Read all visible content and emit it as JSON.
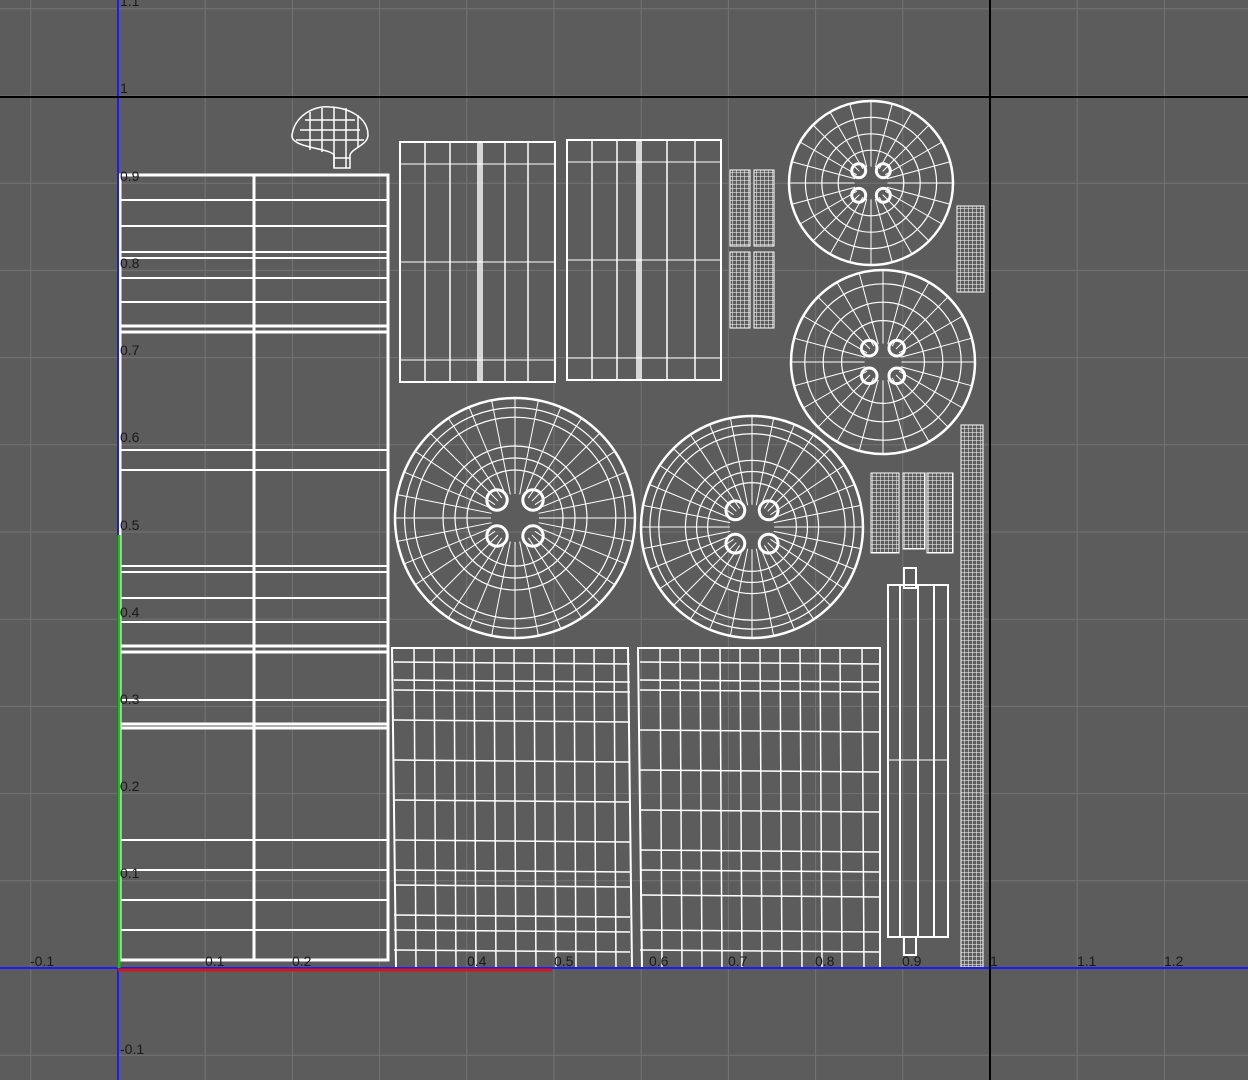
{
  "viewport": {
    "background_color": "#5c5c5c",
    "grid_color": "#737373",
    "uv_wire_color": "#ffffff",
    "u_axis_color": "#1a1aff",
    "v_axis_color": "#1a1aff",
    "u_highlight_color": "#d01818",
    "v_highlight_color": "#19c019",
    "boundary_color": "#000000"
  },
  "axis": {
    "u_ticks": [
      {
        "id": "u-neg0p1",
        "label": "-0.1"
      },
      {
        "id": "u-0p1",
        "label": "0.1"
      },
      {
        "id": "u-0p2",
        "label": "0.2"
      },
      {
        "id": "u-0p4",
        "label": "0.4"
      },
      {
        "id": "u-0p5",
        "label": "0.5"
      },
      {
        "id": "u-0p6",
        "label": "0.6"
      },
      {
        "id": "u-0p7",
        "label": "0.7"
      },
      {
        "id": "u-0p8",
        "label": "0.8"
      },
      {
        "id": "u-0p9",
        "label": "0.9"
      },
      {
        "id": "u-1",
        "label": "1"
      },
      {
        "id": "u-1p1",
        "label": "1.1"
      },
      {
        "id": "u-1p2",
        "label": "1.2"
      }
    ],
    "v_ticks": [
      {
        "id": "v-1p1",
        "label": "1.1"
      },
      {
        "id": "v-1",
        "label": "1"
      },
      {
        "id": "v-0p9",
        "label": "0.9"
      },
      {
        "id": "v-0p8",
        "label": "0.8"
      },
      {
        "id": "v-0p7",
        "label": "0.7"
      },
      {
        "id": "v-0p6",
        "label": "0.6"
      },
      {
        "id": "v-0p5",
        "label": "0.5"
      },
      {
        "id": "v-0p4",
        "label": "0.4"
      },
      {
        "id": "v-0p3",
        "label": "0.3"
      },
      {
        "id": "v-0p2",
        "label": "0.2"
      },
      {
        "id": "v-0p1",
        "label": "0.1"
      },
      {
        "id": "v-neg0p1",
        "label": "-0.1"
      }
    ]
  }
}
